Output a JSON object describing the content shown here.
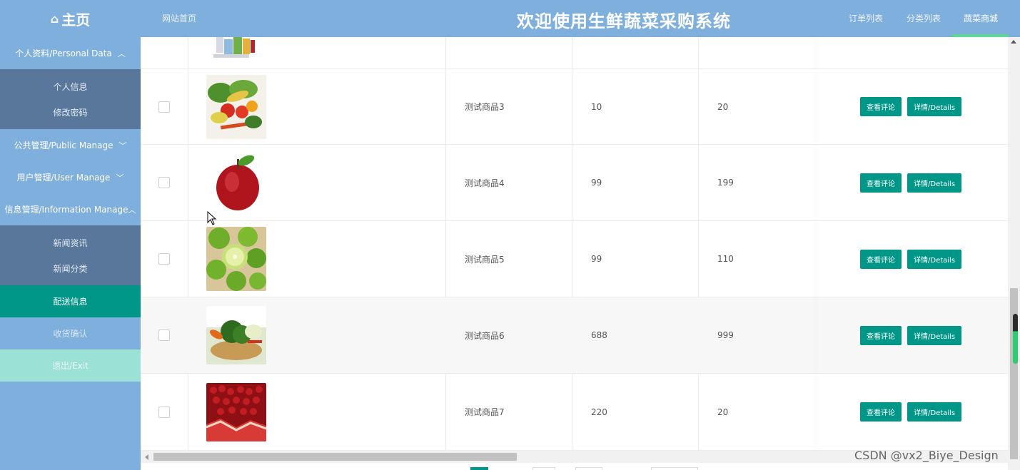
{
  "header": {
    "logo": "主页",
    "site_link": "网站首页",
    "title": "欢迎使用生鲜蔬菜采购系统",
    "nav": [
      {
        "label": "订单列表"
      },
      {
        "label": "分类列表"
      },
      {
        "label": "蔬菜商城",
        "active": true
      }
    ]
  },
  "sidebar": {
    "personal": {
      "label": "个人资料/Personal Data",
      "items": [
        "个人信息",
        "修改密码"
      ]
    },
    "public": {
      "label": "公共管理/Public Manage"
    },
    "user": {
      "label": "用户管理/User Manage"
    },
    "info": {
      "label": "信息管理/Information Manage",
      "items": [
        "新闻资讯",
        "新闻分类"
      ]
    },
    "delivery": {
      "label": "配送信息"
    },
    "receipt": {
      "label": "收货确认"
    },
    "exit": {
      "label": "退出/Exit"
    }
  },
  "table": {
    "rows": [
      {
        "name": "测试商品3",
        "col3": "10",
        "col4": "20",
        "image": "mixed-vegetables"
      },
      {
        "name": "测试商品4",
        "col3": "99",
        "col4": "199",
        "image": "red-apple"
      },
      {
        "name": "测试商品5",
        "col3": "99",
        "col4": "110",
        "image": "limes"
      },
      {
        "name": "测试商品6",
        "col3": "688",
        "col4": "999",
        "image": "broccoli-basket"
      },
      {
        "name": "测试商品7",
        "col3": "220",
        "col4": "20",
        "image": "pomegranate"
      }
    ],
    "actions": {
      "review": "查看评论",
      "details": "详情/Details"
    }
  },
  "watermark": "CSDN @vx2_Biye_Design",
  "colors": {
    "header": "#7fafdc",
    "submenu": "#58779a",
    "accent": "#009688",
    "exit": "#9be1d6"
  }
}
